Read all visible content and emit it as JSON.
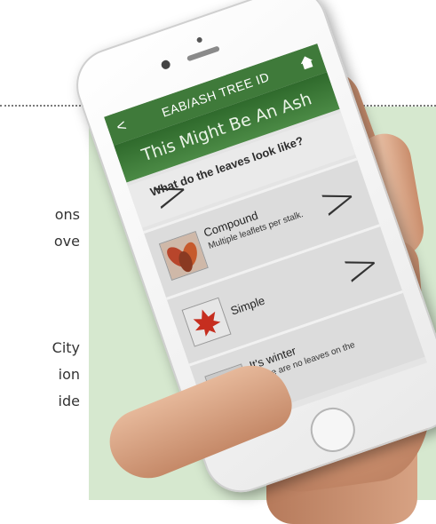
{
  "background": {
    "text_fragments": [
      "ons",
      "ove",
      "City",
      "ion",
      "ide"
    ],
    "panel_color": "#d6e8cf"
  },
  "app": {
    "title": "EAB/ASH TREE ID",
    "back_icon": "<",
    "home_icon": "home-icon",
    "banner": "This Might Be An Ash",
    "question": "What do the leaves look like?",
    "header_color": "#3f7a3a",
    "options": [
      {
        "title": "Compound",
        "subtitle": "Multiple leaflets per stalk.",
        "icon": "compound-leaf-icon"
      },
      {
        "title": "Simple",
        "subtitle": "",
        "icon": "maple-leaf-icon"
      },
      {
        "title": "It's winter",
        "subtitle": "There are no leaves on the tree!",
        "icon": "snowflake-icon"
      }
    ],
    "chevron": ">"
  }
}
